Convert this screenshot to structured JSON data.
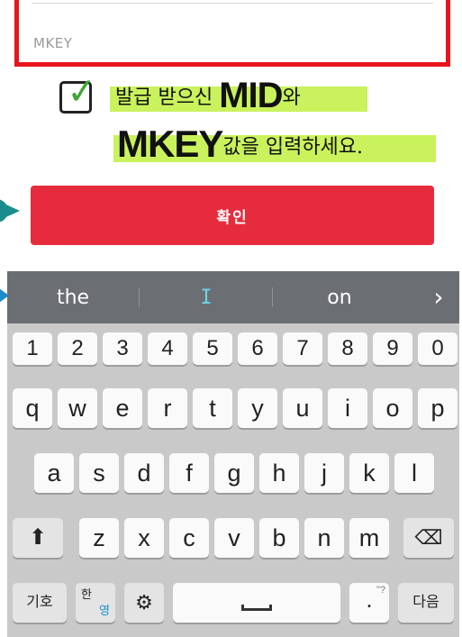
{
  "form": {
    "mkey_label": "MKEY",
    "annotation_line1_pre": "발급 받으신 ",
    "annotation_line1_bold": "MID",
    "annotation_line1_post": "와",
    "annotation_line2_bold": "MKEY",
    "annotation_line2_post": "값을 입력하세요.",
    "confirm_label": "확인"
  },
  "keyboard": {
    "suggestions": [
      "the",
      "I",
      "on"
    ],
    "more": "›",
    "number_row": [
      "1",
      "2",
      "3",
      "4",
      "5",
      "6",
      "7",
      "8",
      "9",
      "0"
    ],
    "row1": [
      "q",
      "w",
      "e",
      "r",
      "t",
      "y",
      "u",
      "i",
      "o",
      "p"
    ],
    "row2": [
      "a",
      "s",
      "d",
      "f",
      "g",
      "h",
      "j",
      "k",
      "l"
    ],
    "row3": [
      "z",
      "x",
      "c",
      "v",
      "b",
      "n",
      "m"
    ],
    "shift": "⬆",
    "backspace": "⌫",
    "symbols": "기호",
    "lang_top": "한",
    "lang_bottom": "영",
    "settings": "⚙",
    "period": ".",
    "period_hint": "\"?",
    "enter": "다음"
  },
  "colors": {
    "red_frame": "#e8141c",
    "confirm_bg": "#e62c3c",
    "highlight": "#c9f25c",
    "arrow_teal": "#1a8c8c"
  }
}
